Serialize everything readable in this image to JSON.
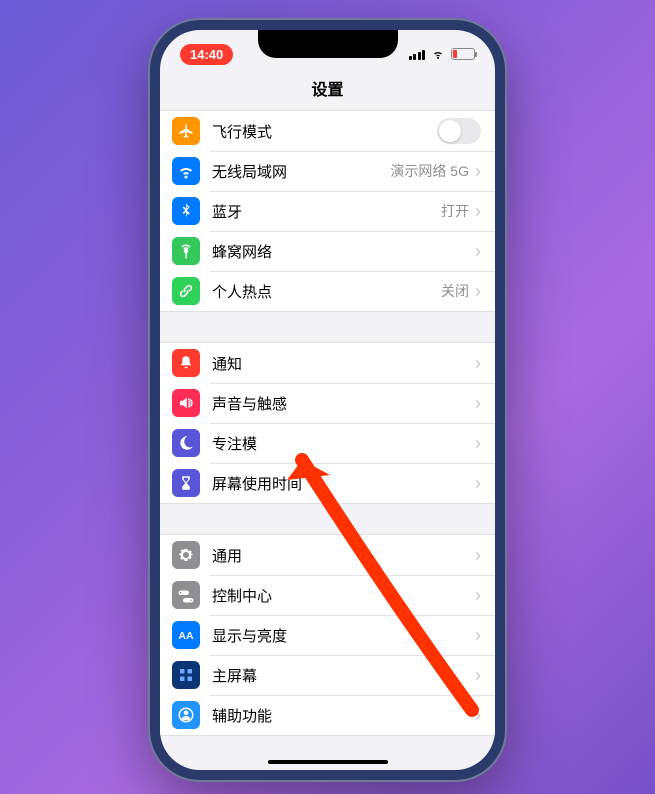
{
  "status": {
    "time": "14:40"
  },
  "header": {
    "title": "设置"
  },
  "groups": [
    {
      "rows": [
        {
          "id": "airplane",
          "label": "飞行模式",
          "detail": "",
          "iconBg": "bg-orange",
          "icon": "airplane",
          "type": "toggle"
        },
        {
          "id": "wifi",
          "label": "无线局域网",
          "detail": "演示网络 5G",
          "iconBg": "bg-blue",
          "icon": "wifi"
        },
        {
          "id": "bluetooth",
          "label": "蓝牙",
          "detail": "打开",
          "iconBg": "bg-blue",
          "icon": "bluetooth"
        },
        {
          "id": "cellular",
          "label": "蜂窝网络",
          "detail": "",
          "iconBg": "bg-green",
          "icon": "antenna"
        },
        {
          "id": "hotspot",
          "label": "个人热点",
          "detail": "关闭",
          "iconBg": "bg-green2",
          "icon": "link"
        }
      ]
    },
    {
      "rows": [
        {
          "id": "notifications",
          "label": "通知",
          "detail": "",
          "iconBg": "bg-red",
          "icon": "bell"
        },
        {
          "id": "sounds",
          "label": "声音与触感",
          "detail": "",
          "iconBg": "bg-pink",
          "icon": "speaker"
        },
        {
          "id": "focus",
          "label": "专注模",
          "detail": "",
          "iconBg": "bg-purple",
          "icon": "moon"
        },
        {
          "id": "screentime",
          "label": "屏幕使用时间",
          "detail": "",
          "iconBg": "bg-purple",
          "icon": "hourglass"
        }
      ]
    },
    {
      "rows": [
        {
          "id": "general",
          "label": "通用",
          "detail": "",
          "iconBg": "bg-gray",
          "icon": "gear"
        },
        {
          "id": "control",
          "label": "控制中心",
          "detail": "",
          "iconBg": "bg-gray",
          "icon": "switches"
        },
        {
          "id": "display",
          "label": "显示与亮度",
          "detail": "",
          "iconBg": "bg-blue",
          "icon": "aa"
        },
        {
          "id": "home",
          "label": "主屏幕",
          "detail": "",
          "iconBg": "bg-darkblue",
          "icon": "grid"
        },
        {
          "id": "accessibility",
          "label": "辅助功能",
          "detail": "",
          "iconBg": "bg-lightblue",
          "icon": "person"
        }
      ]
    }
  ]
}
